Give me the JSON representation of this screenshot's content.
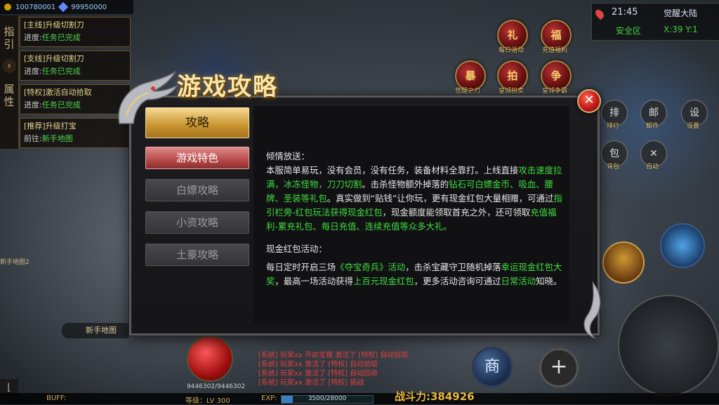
{
  "hud": {
    "gold": "100780001",
    "diamond": "99950000",
    "left_tabs": [
      "指",
      "引",
      "属",
      "性"
    ],
    "quests": [
      {
        "title": "[主线]升级切割刀",
        "progress_label": "进度:",
        "status": "任务已完成"
      },
      {
        "title": "[支线]升级切割刀",
        "progress_label": "进度:",
        "status": "任务已完成"
      },
      {
        "title": "[特权]激活自动拾取",
        "progress_label": "进度:",
        "status": "任务已完成"
      },
      {
        "title": "[推荐]升级打宝",
        "progress_label": "前往:",
        "status": "新手地图"
      }
    ],
    "time": "21:45",
    "map_name": "觉醒大陆",
    "safe_zone": "安全区",
    "coords": "X:39 Y:1",
    "top_icons": [
      {
        "glyph": "礼",
        "label": "每日活动"
      },
      {
        "glyph": "福",
        "label": "充值福利"
      },
      {
        "glyph": "暴",
        "label": "觉醒之力"
      },
      {
        "glyph": "拍",
        "label": "皇城拍卖"
      },
      {
        "glyph": "争",
        "label": "皇城争霸"
      }
    ],
    "right_tools": [
      {
        "glyph": "排",
        "label": "排行"
      },
      {
        "glyph": "邮",
        "label": "邮件"
      },
      {
        "glyph": "设",
        "label": "设置"
      },
      {
        "glyph": "包",
        "label": "背包"
      },
      {
        "glyph": "✕",
        "label": "自动"
      }
    ],
    "new_map": "新手地图",
    "player_label": "新手地图2",
    "hp_value": "9446302/9446302",
    "shop_glyph": "商",
    "plus_glyph": "+",
    "buff_label": "BUFF:",
    "level_label": "等级：LV 300",
    "exp_label": "EXP:",
    "exp_value": "3500/28000",
    "exp_fraction": 0.125,
    "combat_power": "战斗力:384926",
    "chat_lines": [
      "[系统] 玩家xx 开启宝箱 激活了 [特权] 自动拾取",
      "[系统] 玩家xx 激活了 [特权] 自动拾取",
      "[系统] 玩家xx 激活了 [特权] 自动回收",
      "[系统] 玩家xx 激活了 [特权] 挑战"
    ]
  },
  "dialog": {
    "title": "游戏攻略",
    "close_glyph": "✕",
    "tabs": [
      {
        "label": "攻略",
        "style": "active"
      },
      {
        "label": "游戏特色",
        "style": "pink"
      },
      {
        "label": "白嫖攻略",
        "style": "grey"
      },
      {
        "label": "小资攻略",
        "style": "grey"
      },
      {
        "label": "土豪攻略",
        "style": "grey"
      }
    ],
    "section1_heading": "倾情放送：",
    "section1_p1": "本服简单易玩，没有会员，没有任务，装备材料全靠打。上线直接",
    "section1_g1": "攻击速度拉满，冰冻怪物，刀刀切割",
    "section1_p2": "。击杀怪物额外掉落的",
    "section1_g2": "钻石可白嫖金币、吸血、腰牌、圣装等礼包",
    "section1_p3": "。真实做到“贴钱”让你玩，更有现金红包大量相赠，可通过",
    "section1_g3": "指引栏旁-红包玩法获得现金红包",
    "section1_p4": "，现金额度能领取首充之外，还可领取",
    "section1_g4": "充值福利-累充礼包、每日充值、连续充值等众多大礼。",
    "section2_heading": "现金红包活动：",
    "section2_p1": "每日定时开启三场",
    "section2_g1": "《夺宝奇兵》活动",
    "section2_p2": "，击杀宝藏守卫随机掉落",
    "section2_g2": "幸运现金红包大奖",
    "section2_p3": "，最高一场活动获得",
    "section2_g3": "上百元现金红包",
    "section2_p4": "，更多活动咨询可通过",
    "section2_g4": "日常活动",
    "section2_p5": "知晓。"
  },
  "colors": {
    "highlight_green": "#3fdc3f",
    "tab_gold": "#c8932f",
    "tab_pink": "#b84a4a"
  }
}
